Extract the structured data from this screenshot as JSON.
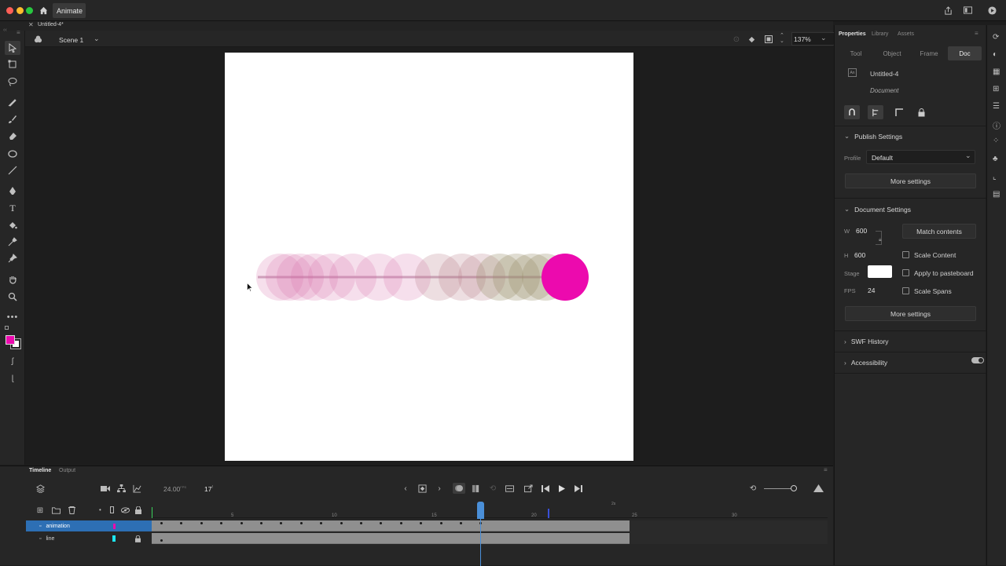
{
  "app": {
    "name": "Animate"
  },
  "document": {
    "tab_title": "Untitled-4*"
  },
  "scene": {
    "name": "Scene 1",
    "zoom": "137%"
  },
  "colors": {
    "accent": "#ec0aae",
    "panel": "#262626",
    "selection": "#2d6fb4",
    "playhead": "#4a8fd8"
  },
  "tools": [
    "selection-icon",
    "free-transform-icon",
    "lasso-icon",
    "brush-icon",
    "paint-brush-icon",
    "eraser-icon",
    "oval-icon",
    "line-icon",
    "pen-icon",
    "text-icon",
    "paint-bucket-icon",
    "eyedropper-icon",
    "pin-icon",
    "hand-icon",
    "zoom-icon",
    "more-icon",
    "color-swatch-icon",
    "stroke-icon",
    "smooth-icon"
  ],
  "properties": {
    "tabs": [
      "Properties",
      "Library",
      "Assets"
    ],
    "subtabs": [
      "Tool",
      "Object",
      "Frame",
      "Doc"
    ],
    "doc_name": "Untitled-4",
    "doc_type": "Document",
    "publish": {
      "title": "Publish Settings",
      "profile_label": "Profile",
      "profile_value": "Default",
      "more": "More settings"
    },
    "docsettings": {
      "title": "Document Settings",
      "w_label": "W",
      "w_value": "600",
      "h_label": "H",
      "h_value": "600",
      "match": "Match contents",
      "scale_content": "Scale Content",
      "stage_label": "Stage",
      "apply_pasteboard": "Apply to pasteboard",
      "fps_label": "FPS",
      "fps_value": "24",
      "scale_spans": "Scale Spans",
      "more": "More settings"
    },
    "swf_history": "SWF History",
    "accessibility": "Accessibility"
  },
  "timeline": {
    "tabs": [
      "Timeline",
      "Output"
    ],
    "fps": "24.00",
    "fps_unit": "FPS",
    "frame": "17",
    "frame_unit": "f",
    "ticks": [
      "5",
      "10",
      "15",
      "20",
      "25",
      "30"
    ],
    "speed_marker": "2s",
    "layers": [
      {
        "name": "animation",
        "color": "#ec0aae"
      },
      {
        "name": "line",
        "color": "#1de6f0"
      }
    ]
  }
}
